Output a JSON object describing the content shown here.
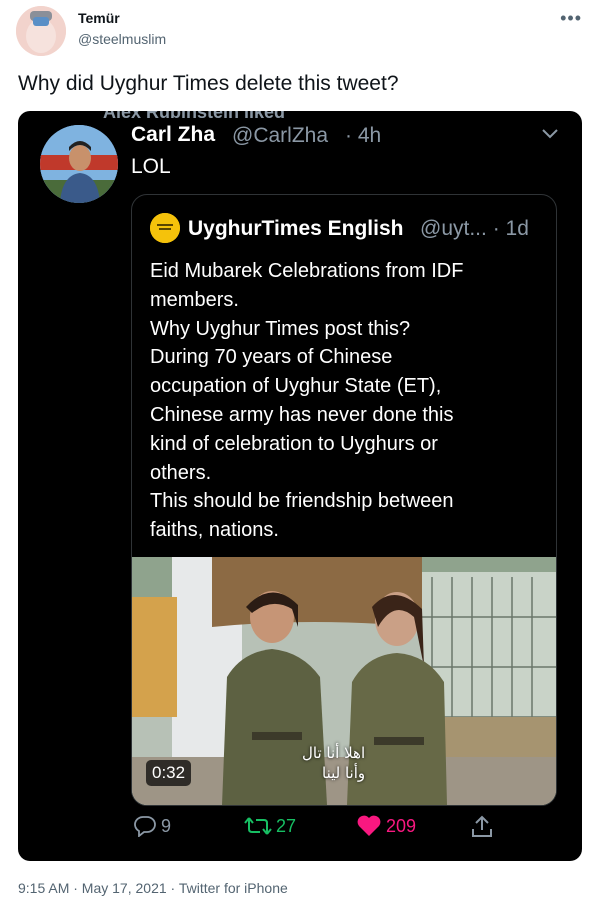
{
  "author": {
    "name": "Temür",
    "handle": "@steelmuslim"
  },
  "tweet": {
    "text": "Why did Uyghur Times delete this tweet?"
  },
  "embedded": {
    "liked_line": "Alex Rubinstein liked",
    "user": {
      "name": "Carl Zha",
      "handle": "@CarlZha",
      "time": "· 4h"
    },
    "text": "LOL",
    "quoted": {
      "name": "UyghurTimes English",
      "handle": "@uyt...",
      "time": "· 1d",
      "text": "Eid Mubarek Celebrations from IDF\nmembers.\nWhy Uyghur Times post this?\nDuring 70 years of Chinese\noccupation of Uyghur State (ET),\nChinese army has never done this\nkind of celebration to Uyghurs or\nothers.\nThis should be friendship between\nfaiths, nations.",
      "video_duration": "0:32",
      "video_subtitle_line1": "اهلا أنا تال",
      "video_subtitle_line2": "وأنا لينا"
    },
    "actions": {
      "replies": "9",
      "retweets": "27",
      "likes": "209"
    }
  },
  "meta": "9:15 AM · May 17, 2021 · Twitter for iPhone",
  "colors": {
    "retweet": "#17bf63",
    "like": "#f91880",
    "muted": "#8b98a5",
    "quote_border": "#2f3336"
  }
}
